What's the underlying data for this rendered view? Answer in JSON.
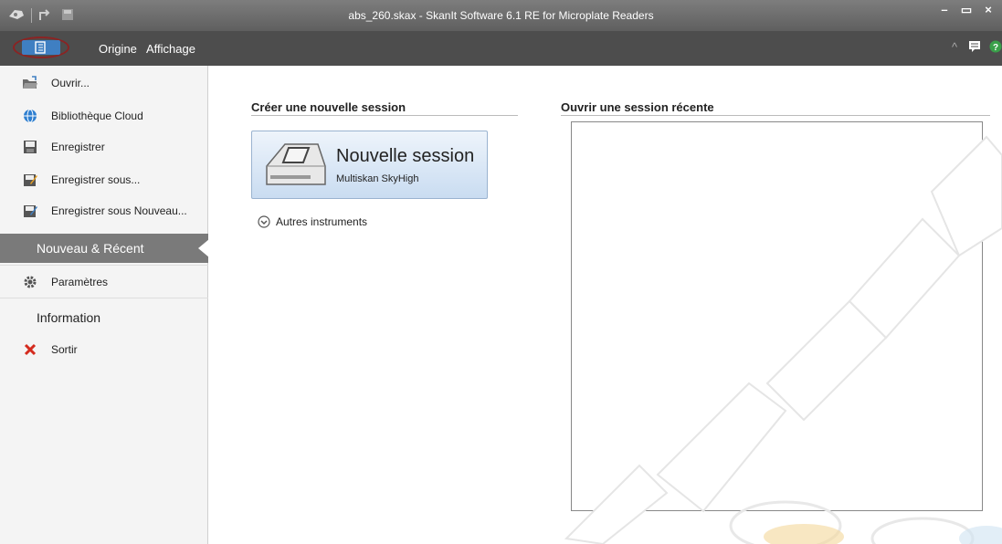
{
  "window": {
    "title": "abs_260.skax - SkanIt Software 6.1 RE for Microplate Readers"
  },
  "window_controls": {
    "minimize": "–",
    "maximize": "▭",
    "close": "×"
  },
  "menubar": {
    "items": [
      "Origine",
      "Affichage"
    ],
    "collapse": "^"
  },
  "sidebar": {
    "items": [
      {
        "label": "Ouvrir...",
        "icon": "open-folder-icon"
      },
      {
        "label": "Bibliothèque Cloud",
        "icon": "globe-icon"
      },
      {
        "label": "Enregistrer",
        "icon": "save-icon"
      },
      {
        "label": "Enregistrer sous...",
        "icon": "save-as-icon"
      },
      {
        "label": "Enregistrer sous Nouveau...",
        "icon": "save-as-new-icon"
      }
    ],
    "active_nav": "Nouveau & Récent",
    "settings": "Paramètres",
    "information": "Information",
    "exit": "Sortir"
  },
  "main": {
    "create_title": "Créer une nouvelle session",
    "new_session": {
      "title": "Nouvelle session",
      "instrument": "Multiskan SkyHigh"
    },
    "other_instruments": "Autres instruments",
    "recent_title": "Ouvrir une session récente"
  },
  "colors": {
    "accent": "#3f7fc2",
    "titlebar": "#6b6b6b",
    "menubar": "#4d4d4d",
    "active_nav": "#7a7a7a",
    "exit_icon": "#d42b1e"
  }
}
